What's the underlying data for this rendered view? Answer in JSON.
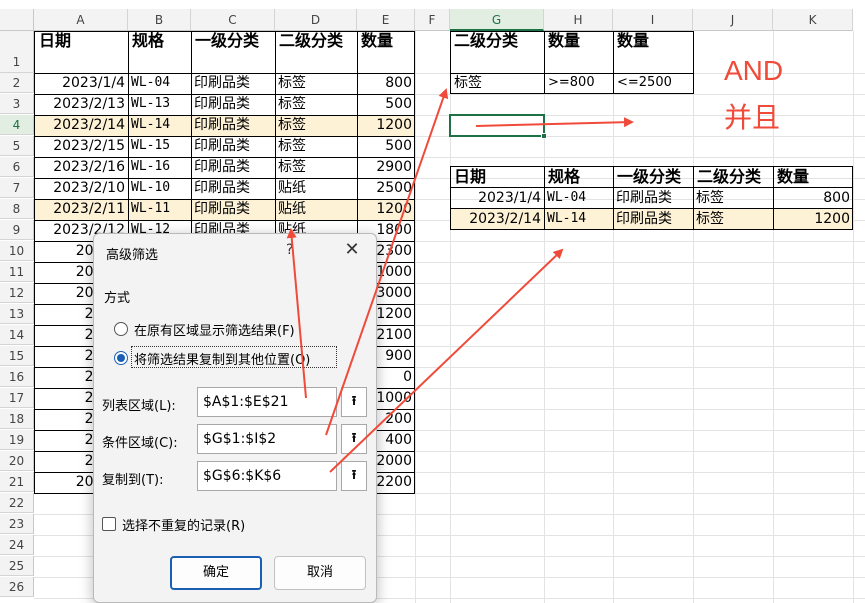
{
  "columns": [
    "A",
    "B",
    "C",
    "D",
    "E",
    "F",
    "G",
    "H",
    "I",
    "J",
    "K"
  ],
  "rows": [
    "1",
    "2",
    "3",
    "4",
    "5",
    "6",
    "7",
    "8",
    "9",
    "10",
    "11",
    "12",
    "13",
    "14",
    "15",
    "16",
    "17",
    "18",
    "19",
    "20",
    "21",
    "22",
    "23",
    "24",
    "25",
    "26"
  ],
  "main_table": {
    "headers": [
      "日期",
      "规格",
      "一级分类",
      "二级分类",
      "数量"
    ],
    "rows": [
      [
        "2023/1/4",
        "WL-04",
        "印刷品类",
        "标签",
        "800"
      ],
      [
        "2023/2/13",
        "WL-13",
        "印刷品类",
        "标签",
        "500"
      ],
      [
        "2023/2/14",
        "WL-14",
        "印刷品类",
        "标签",
        "1200"
      ],
      [
        "2023/2/15",
        "WL-15",
        "印刷品类",
        "标签",
        "500"
      ],
      [
        "2023/2/16",
        "WL-16",
        "印刷品类",
        "标签",
        "2900"
      ],
      [
        "2023/2/10",
        "WL-10",
        "印刷品类",
        "贴纸",
        "2500"
      ],
      [
        "2023/2/11",
        "WL-11",
        "印刷品类",
        "贴纸",
        "1200"
      ],
      [
        "2023/2/12",
        "WL-12",
        "印刷品类",
        "贴纸",
        "1800"
      ],
      [
        "2023/2",
        "",
        "",
        "",
        "2300"
      ],
      [
        "2023/2",
        "",
        "",
        "",
        "1000"
      ],
      [
        "2023/2",
        "",
        "",
        "",
        "3000"
      ],
      [
        "2023/",
        "",
        "",
        "",
        "1200"
      ],
      [
        "2023/",
        "",
        "",
        "",
        "2100"
      ],
      [
        "2023/",
        "",
        "",
        "",
        "900"
      ],
      [
        "2023/",
        "",
        "",
        "",
        "0"
      ],
      [
        "2023/",
        "",
        "",
        "",
        "1000"
      ],
      [
        "2023/",
        "",
        "",
        "",
        "200"
      ],
      [
        "2023/",
        "",
        "",
        "",
        "400"
      ],
      [
        "2023/",
        "",
        "",
        "",
        "2000"
      ],
      [
        "2023/2",
        "",
        "",
        "",
        "2200"
      ]
    ]
  },
  "criteria": {
    "headers": [
      "二级分类",
      "数量",
      "数量"
    ],
    "values": [
      "标签",
      ">=800",
      "<=2500"
    ]
  },
  "annotation": {
    "line1": "AND",
    "line2": "并且"
  },
  "result_table": {
    "headers": [
      "日期",
      "规格",
      "一级分类",
      "二级分类",
      "数量"
    ],
    "rows": [
      [
        "2023/1/4",
        "WL-04",
        "印刷品类",
        "标签",
        "800"
      ],
      [
        "2023/2/14",
        "WL-14",
        "印刷品类",
        "标签",
        "1200"
      ]
    ]
  },
  "dialog": {
    "title": "高级筛选",
    "help": "?",
    "close": "✕",
    "group_label": "方式",
    "radio_inplace": "在原有区域显示筛选结果(F)",
    "radio_copy": "将筛选结果复制到其他位置(O)",
    "list_range_label": "列表区域(L):",
    "list_range_value": "$A$1:$E$21",
    "criteria_range_label": "条件区域(C):",
    "criteria_range_value": "$G$1:$I$2",
    "copy_to_label": "复制到(T):",
    "copy_to_value": "$G$6:$K$6",
    "collapse_glyph": "⭱",
    "unique_label": "选择不重复的记录(R)",
    "ok_label": "确定",
    "cancel_label": "取消"
  },
  "colors": {
    "accent": "#1e7145",
    "highlight": "#fdf1d6",
    "arrow": "#f04a3a",
    "dialog_accent": "#1a5fb4"
  }
}
